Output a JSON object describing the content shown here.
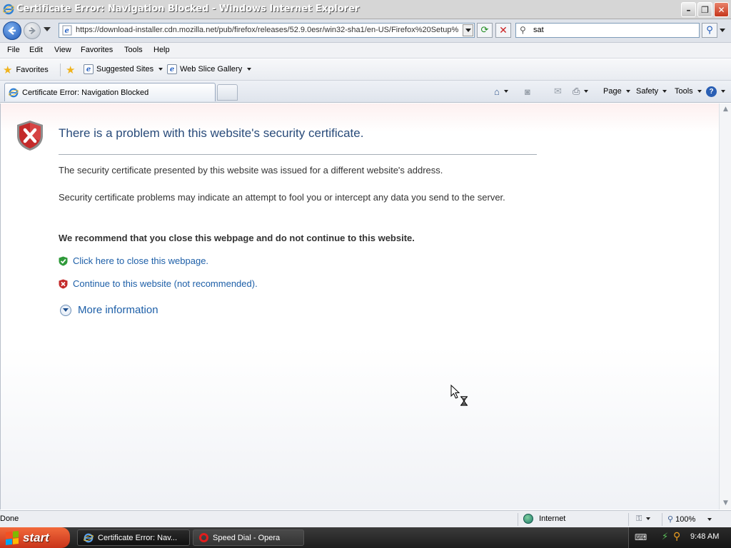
{
  "window": {
    "title": "Certificate Error: Navigation Blocked - Windows Internet Explorer",
    "buttons": {
      "minimize": "–",
      "restore": "❐",
      "close": "✕"
    }
  },
  "address_bar": {
    "url": "https://download-installer.cdn.mozilla.net/pub/firefox/releases/52.9.0esr/win32-sha1/en-US/Firefox%20Setup%",
    "search_value": "sat"
  },
  "menu": [
    "File",
    "Edit",
    "View",
    "Favorites",
    "Tools",
    "Help"
  ],
  "favorites_bar": {
    "favorites_label": "Favorites",
    "links": [
      "Suggested Sites",
      "Web Slice Gallery"
    ]
  },
  "tabs": {
    "active_label": "Certificate Error: Navigation Blocked"
  },
  "command_bar": {
    "page_label": "Page",
    "safety_label": "Safety",
    "tools_label": "Tools"
  },
  "error_page": {
    "title": "There is a problem with this website's security certificate.",
    "paragraph1": "The security certificate presented by this website was issued for a different website's address.",
    "paragraph2": "Security certificate problems may indicate an attempt to fool you or intercept any data you send to the server.",
    "recommendation": "We recommend that you close this webpage and do not continue to this website.",
    "close_link": "Click here to close this webpage.",
    "continue_link": "Continue to this website (not recommended).",
    "more_info": "More information"
  },
  "status_bar": {
    "status": "Done",
    "zone": "Internet",
    "zoom": "100%"
  },
  "taskbar": {
    "start_label": "start",
    "tasks": [
      "Certificate Error: Nav...",
      "Speed Dial - Opera"
    ],
    "clock": "9:48 AM"
  },
  "colors": {
    "link": "#1d5fa8",
    "title_text": "#294b7a",
    "shield_red": "#c42b2b",
    "shield_green": "#2f9a3a"
  }
}
